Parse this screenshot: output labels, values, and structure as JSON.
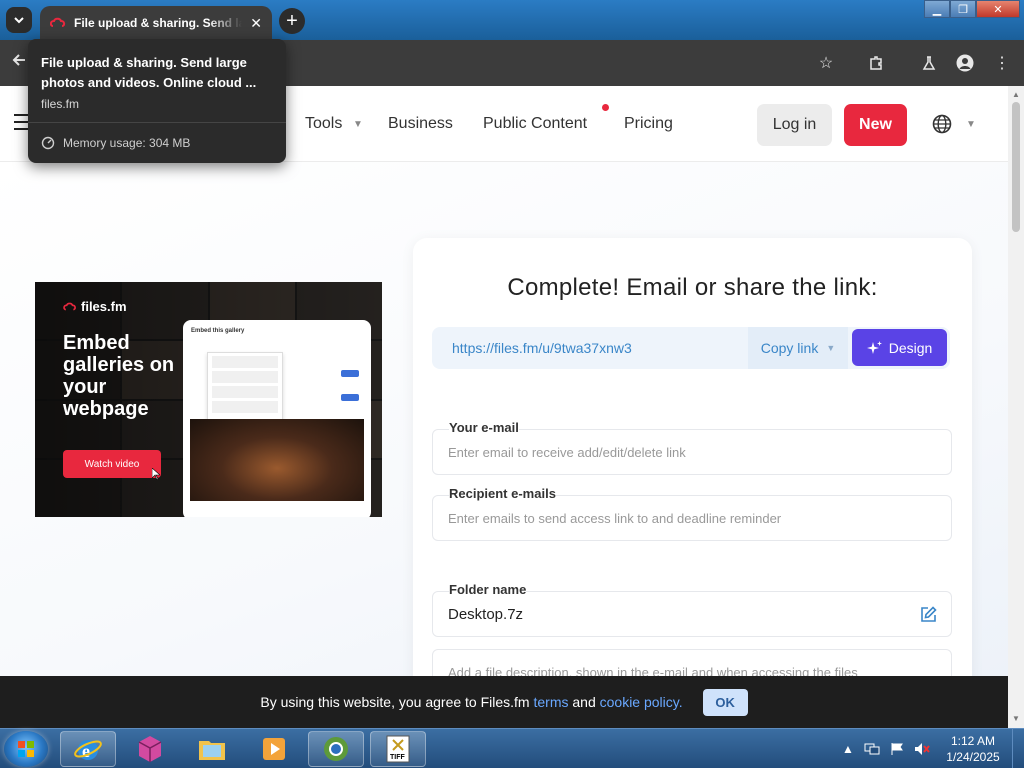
{
  "browser": {
    "tab_title": "File upload & sharing. Send large photos and videos. Online cloud storage",
    "tooltip": {
      "title": "File upload & sharing. Send large photos and videos. Online cloud ...",
      "domain": "files.fm",
      "memory": "Memory usage: 304 MB"
    }
  },
  "header": {
    "nav": [
      {
        "label": "Tools"
      },
      {
        "label": "Business"
      },
      {
        "label": "Public Content"
      },
      {
        "label": "Pricing"
      }
    ],
    "login_label": "Log in",
    "new_label": "New"
  },
  "banner": {
    "logo_text": "files.fm",
    "headline": "Embed galleries on your webpage",
    "button": "Watch video",
    "card_title": "Embed this gallery"
  },
  "share": {
    "title": "Complete! Email or share the link:",
    "link": "https://files.fm/u/9twa37xnw3",
    "copy_label": "Copy link",
    "design_label": "Design",
    "your_email_label": "Your e-mail",
    "your_email_placeholder": "Enter email to receive add/edit/delete link",
    "recipients_label": "Recipient e-mails",
    "recipients_placeholder": "Enter emails to send access link to and deadline reminder",
    "folder_label": "Folder name",
    "folder_value": "Desktop.7z",
    "description_placeholder": "Add a file description, shown in the e-mail and when accessing the files"
  },
  "cookie": {
    "text_before": "By using this website, you agree to Files.fm ",
    "terms": "terms",
    "and": " and ",
    "cookie_policy": "cookie policy.",
    "ok": "OK"
  },
  "taskbar": {
    "time": "1:12 AM",
    "date": "1/24/2025"
  },
  "colors": {
    "brand_red": "#e8283e",
    "design_purple": "#5a43e6",
    "link_blue": "#3a86c8"
  }
}
